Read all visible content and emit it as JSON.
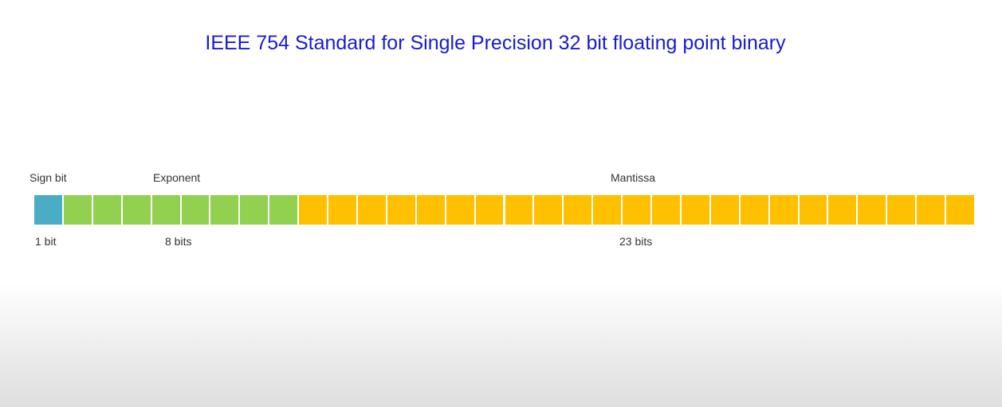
{
  "title": "IEEE 754 Standard for Single Precision 32 bit floating point binary",
  "fields": [
    {
      "name": "Sign bit",
      "size_label": "1 bit",
      "bits": 1,
      "color": "#4bacc6"
    },
    {
      "name": "Exponent",
      "size_label": "8 bits",
      "bits": 8,
      "color": "#92d050"
    },
    {
      "name": "Mantissa",
      "size_label": "23 bits",
      "bits": 23,
      "color": "#ffc000"
    }
  ],
  "total_bits": 32
}
